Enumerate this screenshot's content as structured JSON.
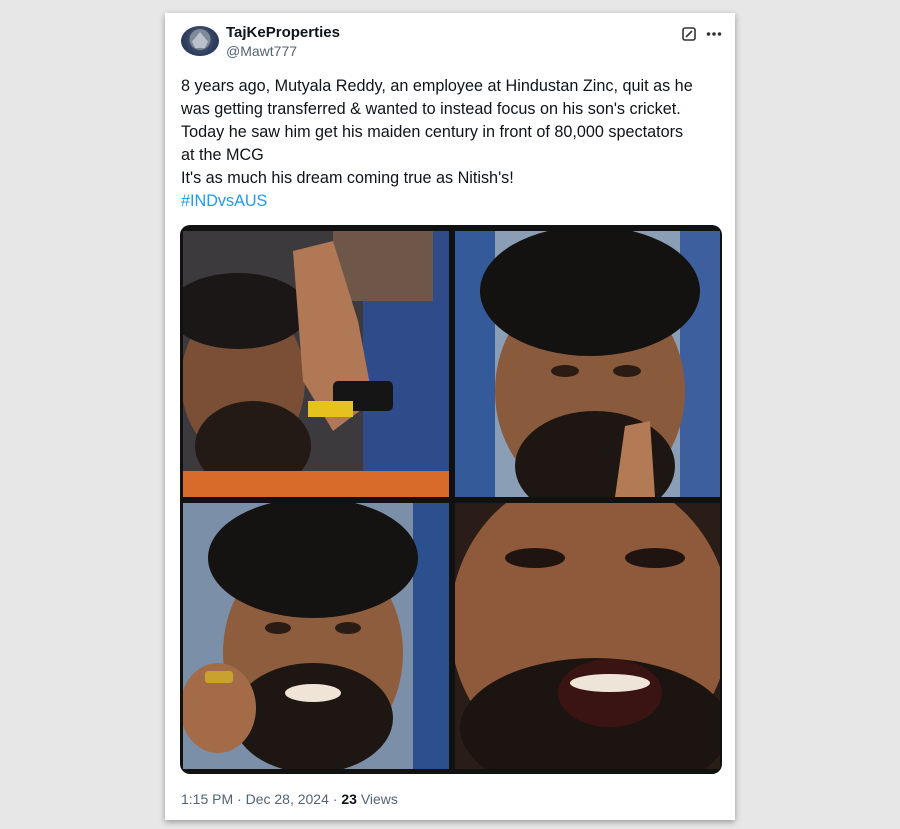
{
  "tweet": {
    "display_name": "TajKeProperties",
    "handle": "@Mawt777",
    "text_lines": [
      "8 years ago, Mutyala Reddy, an employee at Hindustan Zinc, quit as he",
      "was getting transferred  & wanted to instead focus on his son's cricket.",
      "Today he saw him get his maiden century in front of 80,000 spectators",
      "at the MCG",
      "It's as much his dream coming true as Nitish's!"
    ],
    "hashtag": "#INDvsAUS",
    "time": "1:15 PM",
    "separator": "·",
    "date": "Dec 28, 2024",
    "views_count": "23",
    "views_label": "Views"
  },
  "media": {
    "photos": [
      {
        "icon": "photo-crying-man-praying"
      },
      {
        "icon": "photo-man-hands-folded"
      },
      {
        "icon": "photo-man-fist-raised"
      },
      {
        "icon": "photo-man-crying-closeup"
      }
    ]
  },
  "icons": {
    "grok": "grok-icon",
    "more": "more-options-icon"
  },
  "colors": {
    "link": "#1d9bf0",
    "secondary_text": "#536471",
    "primary_text": "#0f1419"
  }
}
